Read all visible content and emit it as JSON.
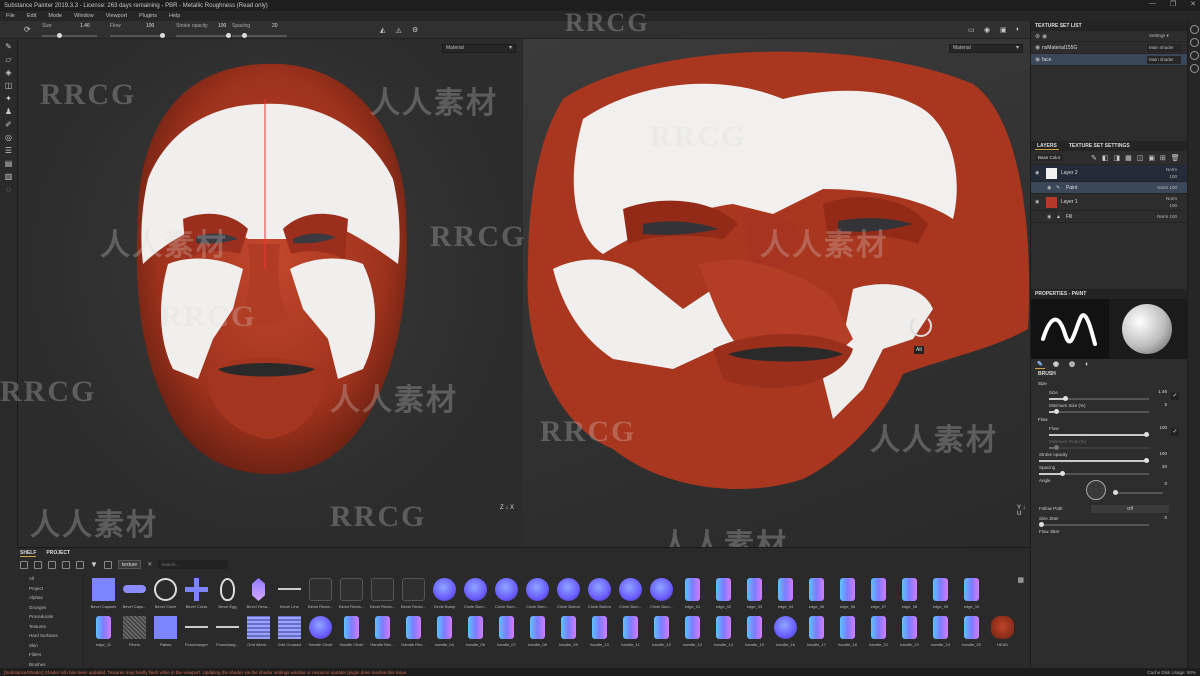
{
  "window": {
    "title": "Substance Painter 2019.3.3 - License: 263 days remaining - PBR - Metallic Roughness (Read only)",
    "controls": [
      "—",
      "❐",
      "✕"
    ]
  },
  "menu": [
    "File",
    "Edit",
    "Mode",
    "Window",
    "Viewport",
    "Plugins",
    "Help"
  ],
  "toolbar": {
    "size_label": "Size",
    "size_value": "1.46",
    "flow_label": "Flow",
    "flow_value": "100",
    "opacity_label": "Stroke opacity",
    "opacity_value": "100",
    "spacing_label": "Spacing",
    "spacing_value": "20",
    "size_level": 0.3,
    "flow_level": 1.0,
    "opacity_level": 1.0,
    "spacing_level": 0.2
  },
  "viewports": {
    "left_mode": "Material",
    "right_mode": "Material",
    "left_axes": "Z\n↓ X",
    "right_axes": "Y\n↓ U",
    "tooltip": "Alt"
  },
  "watermark": "RRCG",
  "watermark_cn": "人人素材",
  "texture_set_list": {
    "title": "TEXTURE SET LIST",
    "settings": "Settings ▾",
    "items": [
      {
        "name": "nsMaterial155G",
        "shader": "Main shader",
        "selected": false
      },
      {
        "name": "face",
        "shader": "Main shader",
        "selected": true
      }
    ]
  },
  "layers": {
    "tab_layers": "LAYERS",
    "tab_settings": "TEXTURE SET SETTINGS",
    "channel": "Base Color",
    "rows": [
      {
        "name": "Layer 2",
        "blend": "Norm",
        "opacity": "100",
        "kind": "layer",
        "thumb": "#f0f0f0"
      },
      {
        "name": "Paint",
        "blend": "Norm",
        "opacity": "100",
        "kind": "effect",
        "thumb": "#ffffff"
      },
      {
        "name": "Layer 1",
        "blend": "Norm",
        "opacity": "100",
        "kind": "layer",
        "thumb": "#b23a26"
      },
      {
        "name": "Fill",
        "blend": "Norm",
        "opacity": "100",
        "kind": "effect",
        "thumb": "#ffffff"
      }
    ]
  },
  "properties": {
    "title": "PROPERTIES - PAINT",
    "brush_section": "BRUSH",
    "size_group": "Size",
    "sliders": [
      {
        "label": "Size",
        "value": "1.46",
        "level": 0.15
      },
      {
        "label": "Minimum Size (%)",
        "value": "5",
        "level": 0.05
      },
      {
        "label": "Flow",
        "value": "100",
        "level": 1.0
      },
      {
        "label": "Minimum Flow (%)",
        "value": "",
        "level": 0.05
      },
      {
        "label": "Stroke opacity",
        "value": "100",
        "level": 1.0
      },
      {
        "label": "Spacing",
        "value": "20",
        "level": 0.2
      }
    ],
    "flow_group": "Flow",
    "angle_label": "Angle",
    "angle_value": "0",
    "follow_path_label": "Follow Path",
    "follow_path_value": "Off",
    "size_jitter_label": "Size Jitter",
    "size_jitter_value": "0",
    "flow_jitter_label": "Flow Jitter",
    "flow_jitter_value": "0"
  },
  "shelf": {
    "tab_shelf": "SHELF",
    "tab_project": "PROJECT",
    "filter_chip": "texture",
    "search_placeholder": "Search...",
    "categories": [
      "All",
      "Project",
      "Alphas",
      "Grunges",
      "Procedurals",
      "Textures",
      "Hard Surfaces",
      "Skin",
      "Filters",
      "Brushes"
    ],
    "row1": [
      {
        "label": "Bevel Capsule",
        "shape": "square-blue"
      },
      {
        "label": "Bevel Caps...",
        "shape": "capsule"
      },
      {
        "label": "Bevel Circle",
        "shape": "circle-outline"
      },
      {
        "label": "Bevel Cross",
        "shape": "cross"
      },
      {
        "label": "Bevel Egg",
        "shape": "egg"
      },
      {
        "label": "Bevel Hexa...",
        "shape": "hex"
      },
      {
        "label": "Bevel Line",
        "shape": "line"
      },
      {
        "label": "Bevel Recta...",
        "shape": "rect-dark"
      },
      {
        "label": "Bevel Recta...",
        "shape": "rect-dark"
      },
      {
        "label": "Bevel Recta...",
        "shape": "rect-dark"
      },
      {
        "label": "Bevel Recta...",
        "shape": "rect-dark"
      },
      {
        "label": "Circle Bump",
        "shape": "bump"
      },
      {
        "label": "Circle Bum...",
        "shape": "bump"
      },
      {
        "label": "Circle Bum...",
        "shape": "bump"
      },
      {
        "label": "Circle Bum...",
        "shape": "bump"
      },
      {
        "label": "Circle Button",
        "shape": "bump"
      },
      {
        "label": "Circle Button",
        "shape": "bump"
      },
      {
        "label": "Circle Bum...",
        "shape": "bump"
      },
      {
        "label": "Circle Bum...",
        "shape": "bump"
      },
      {
        "label": "edge_01",
        "shape": "edge"
      },
      {
        "label": "edge_02",
        "shape": "edge"
      },
      {
        "label": "edge_03",
        "shape": "edge"
      },
      {
        "label": "edge_04",
        "shape": "edge"
      },
      {
        "label": "edge_05",
        "shape": "edge"
      },
      {
        "label": "edge_06",
        "shape": "edge"
      },
      {
        "label": "edge_07",
        "shape": "edge"
      },
      {
        "label": "edge_08",
        "shape": "edge"
      },
      {
        "label": "edge_09",
        "shape": "edge"
      },
      {
        "label": "edge_10",
        "shape": "edge"
      }
    ],
    "row2": [
      {
        "label": "edge_11",
        "shape": "edge"
      },
      {
        "label": "Fibers",
        "shape": "noise"
      },
      {
        "label": "Flakes",
        "shape": "square-blue"
      },
      {
        "label": "Flowchanger",
        "shape": "line"
      },
      {
        "label": "Flowchang...",
        "shape": "line"
      },
      {
        "label": "Grid Altern...",
        "shape": "grid"
      },
      {
        "label": "Grid Crossed",
        "shape": "grid"
      },
      {
        "label": "Handle Circle",
        "shape": "bump"
      },
      {
        "label": "Handle Circle",
        "shape": "edge"
      },
      {
        "label": "Handle Rec...",
        "shape": "edge"
      },
      {
        "label": "Handle Rec...",
        "shape": "edge"
      },
      {
        "label": "handle_04",
        "shape": "edge"
      },
      {
        "label": "handle_06",
        "shape": "edge"
      },
      {
        "label": "handle_07",
        "shape": "edge"
      },
      {
        "label": "handle_08",
        "shape": "edge"
      },
      {
        "label": "handle_09",
        "shape": "edge"
      },
      {
        "label": "handle_10",
        "shape": "edge"
      },
      {
        "label": "handle_11",
        "shape": "edge"
      },
      {
        "label": "handle_12",
        "shape": "edge"
      },
      {
        "label": "handle_13",
        "shape": "edge"
      },
      {
        "label": "handle_14",
        "shape": "edge"
      },
      {
        "label": "handle_15",
        "shape": "edge"
      },
      {
        "label": "handle_16",
        "shape": "bump"
      },
      {
        "label": "handle_17",
        "shape": "edge"
      },
      {
        "label": "handle_18",
        "shape": "edge"
      },
      {
        "label": "handle_22",
        "shape": "edge"
      },
      {
        "label": "handle_23",
        "shape": "edge"
      },
      {
        "label": "handle_24",
        "shape": "edge"
      },
      {
        "label": "handle_25",
        "shape": "edge"
      },
      {
        "label": "HEAD",
        "shape": "head"
      }
    ]
  },
  "status": {
    "warning": "[Substance/Shader] Shader info has been updated. Textures may briefly flash while in the viewport. Updating the shader via the shader settings window or resource updater plugin does resolve this issue.",
    "cache": "Cache Disk Usage: 80%"
  },
  "colors": {
    "accent": "#cfa043",
    "selection": "#3b4859",
    "face_red": "#a8361f",
    "face_white": "#f2f2f2",
    "warning": "#d36b4e"
  }
}
